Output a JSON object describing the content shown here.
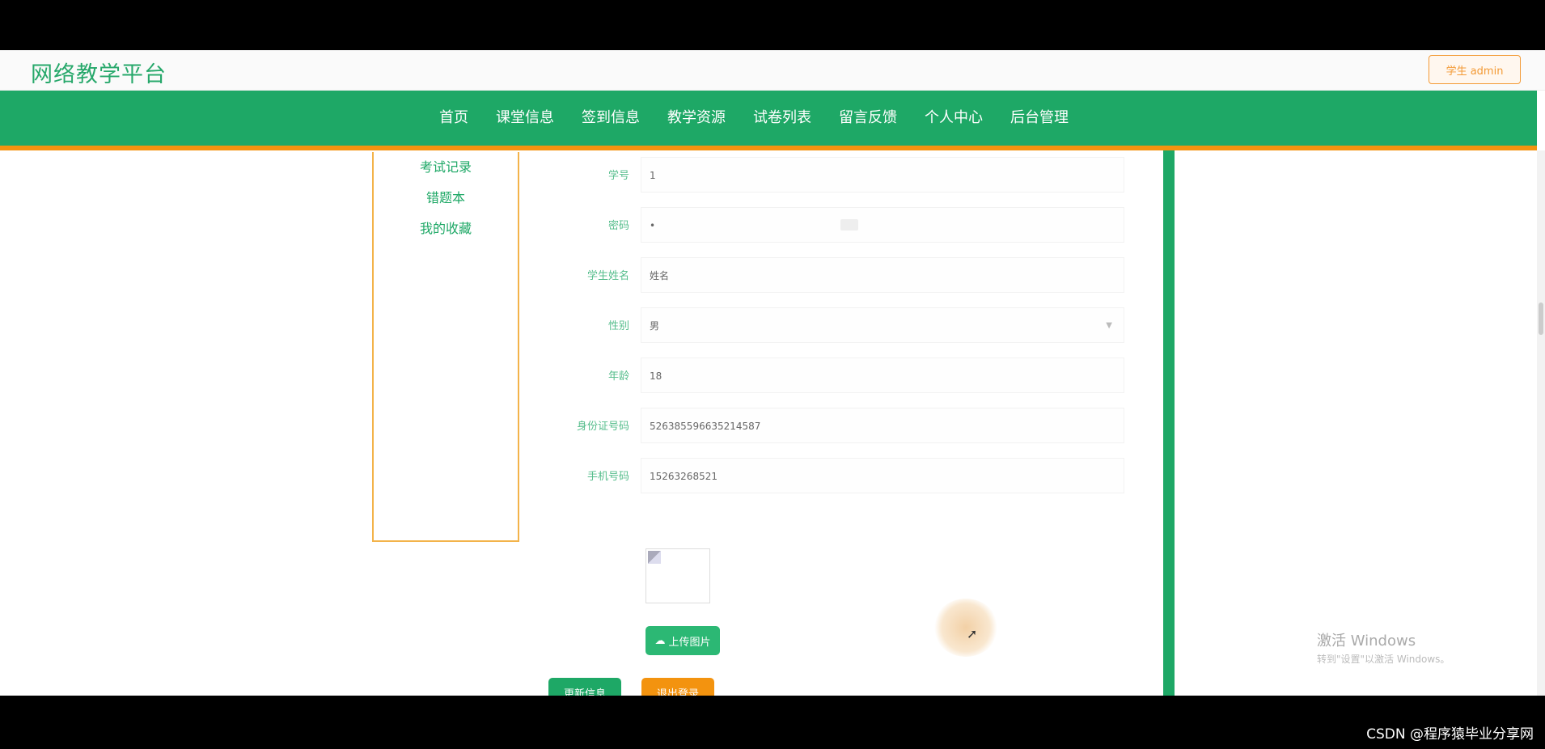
{
  "header": {
    "brand": "网络教学平台",
    "user_badge": "学生 admin"
  },
  "nav": {
    "items": [
      "首页",
      "课堂信息",
      "签到信息",
      "教学资源",
      "试卷列表",
      "留言反馈",
      "个人中心",
      "后台管理"
    ]
  },
  "sidebar": {
    "items": [
      "考试记录",
      "错题本",
      "我的收藏"
    ]
  },
  "form": {
    "fields": [
      {
        "label": "学号",
        "value": "1"
      },
      {
        "label": "密码",
        "value": "•"
      },
      {
        "label": "学生姓名",
        "value": "姓名"
      },
      {
        "label": "性别",
        "value": "男"
      },
      {
        "label": "年龄",
        "value": "18"
      },
      {
        "label": "身份证号码",
        "value": "526385596635214587"
      },
      {
        "label": "手机号码",
        "value": "15263268521"
      }
    ],
    "upload_label": "上传图片",
    "update_label": "更新信息",
    "logout_label": "退出登录"
  },
  "watermark": {
    "title": "激活 Windows",
    "subtitle": "转到\"设置\"以激活 Windows。"
  },
  "footer": {
    "credit": "CSDN @程序猿毕业分享网"
  },
  "colors": {
    "primary": "#1ea866",
    "accent": "#f3930f"
  }
}
